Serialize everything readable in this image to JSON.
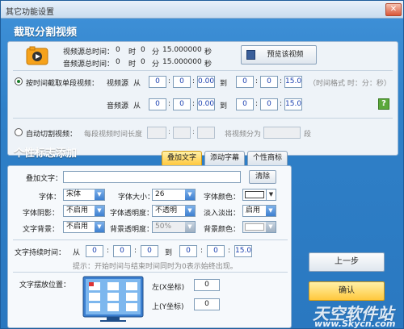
{
  "window": {
    "title": "其它功能设置",
    "close": "✕"
  },
  "capture": {
    "heading": "截取分割视频",
    "video_total_label": "视频源总时间：",
    "audio_total_label": "音频源总时间：",
    "video_total": {
      "h": "0",
      "h_unit": "时",
      "m": "0",
      "m_unit": "分",
      "s": "15.000000",
      "s_unit": "秒"
    },
    "audio_total": {
      "h": "0",
      "h_unit": "时",
      "m": "0",
      "m_unit": "分",
      "s": "15.000000",
      "s_unit": "秒"
    },
    "preview_button": "预览该视频",
    "mode_time_label": "按时间截取单段视频：",
    "video_source": "视频源",
    "audio_source": "音频源",
    "from": "从",
    "to": "到",
    "video_from": [
      "0",
      "0",
      "0.00"
    ],
    "video_to": [
      "0",
      "0",
      "15.0"
    ],
    "audio_from": [
      "0",
      "0",
      "0.00"
    ],
    "audio_to": [
      "0",
      "0",
      "15.0"
    ],
    "format_hint": "（时间格式 时：分：秒）",
    "help": "?",
    "mode_auto_label": "自动切割视频：",
    "segment_length_label": "每段视频时间长度",
    "split_into_label": "将视频分为",
    "segment_unit": "段",
    "colon": ":"
  },
  "logo": {
    "heading": "个性标志添加",
    "tabs": [
      "叠加文字",
      "添动字幕",
      "个性商标"
    ],
    "overlay_text_label": "叠加文字：",
    "overlay_text_value": "",
    "clear_button": "清除",
    "font_label": "字体：",
    "font_value": "宋体",
    "font_size_label": "字体大小：",
    "font_size_value": "26",
    "font_color_label": "字体颜色：",
    "font_color": "#ffffff",
    "shadow_label": "字体阴影：",
    "shadow_value": "不启用",
    "transparency_label": "字体透明度：",
    "transparency_value": "不透明",
    "fade_label": "淡入淡出：",
    "fade_value": "启用",
    "text_bg_label": "文字背景：",
    "text_bg_value": "不启用",
    "bg_transparency_label": "背景透明度：",
    "bg_transparency_value": "50%",
    "bg_color_label": "背景颜色：",
    "bg_color": "#ffffff",
    "duration_label": "文字持续时间：",
    "from": "从",
    "to": "到",
    "duration_from": [
      "0",
      "0",
      "0"
    ],
    "duration_to": [
      "0",
      "0",
      "15.0"
    ],
    "duration_hint": "提示：开始时间与结束时间同时为0表示始终出现。",
    "position_label": "文字摆放位置：",
    "x_label": "左(X坐标)",
    "x_value": "0",
    "y_label": "上(Y坐标)",
    "y_value": "0",
    "colon": ":"
  },
  "actions": {
    "prev": "上一步",
    "ok": "确认"
  },
  "watermark": {
    "cn": "天空软件站",
    "url": "www.Skycn.com"
  }
}
